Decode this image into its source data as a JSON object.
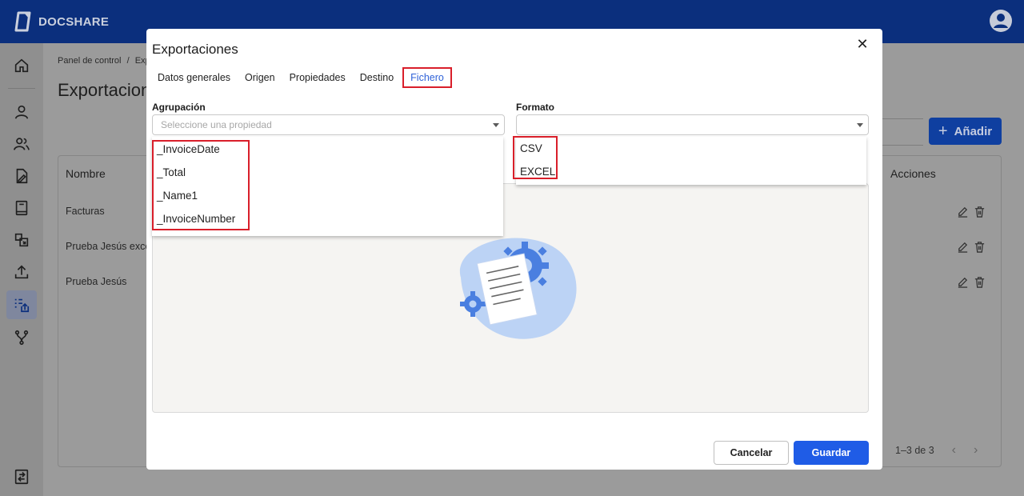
{
  "app": {
    "brand": "DOCSHARE"
  },
  "breadcrumb": {
    "home": "Panel de control",
    "separator": "/",
    "current": "Exp"
  },
  "page": {
    "title": "Exportacion"
  },
  "toolbar": {
    "add_label": "Añadir"
  },
  "table": {
    "columns": {
      "name": "Nombre",
      "actions": "Acciones"
    },
    "rows": [
      "Facturas",
      "Prueba Jesús exce",
      "Prueba Jesús"
    ],
    "pagination": "1–3 de 3"
  },
  "modal": {
    "title": "Exportaciones",
    "tabs": [
      "Datos generales",
      "Origen",
      "Propiedades",
      "Destino",
      "Fichero"
    ],
    "active_tab": "Fichero",
    "grouping": {
      "label": "Agrupación",
      "placeholder": "Seleccione una propiedad",
      "options": [
        "_InvoiceDate",
        "_Total",
        "_Name1",
        "_InvoiceNumber"
      ]
    },
    "format": {
      "label": "Formato",
      "value": "",
      "options": [
        "CSV",
        "EXCEL"
      ]
    },
    "buttons": {
      "cancel": "Cancelar",
      "save": "Guardar"
    }
  },
  "colors": {
    "topbar": "#0b2f7d",
    "primary": "#1f5ce6",
    "highlight": "#d91f2a"
  }
}
